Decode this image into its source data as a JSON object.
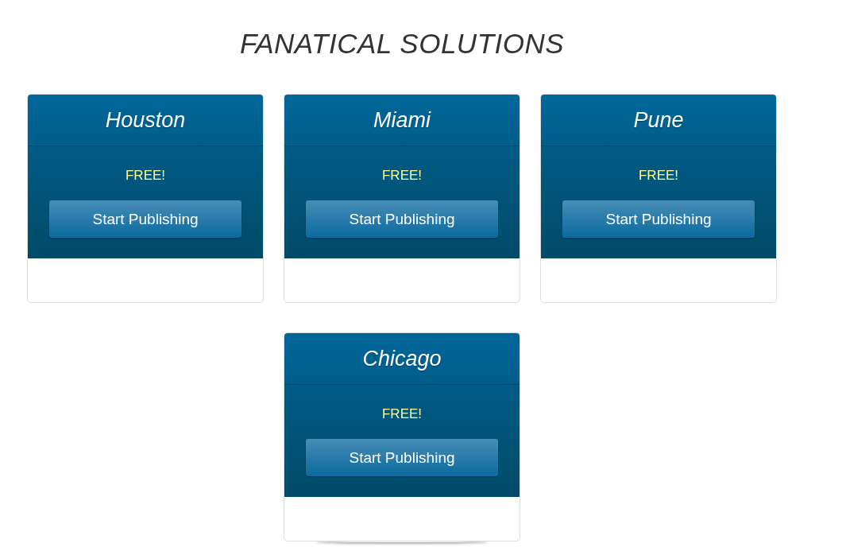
{
  "title": "FANATICAL SOLUTIONS",
  "plans": [
    {
      "city": "Houston",
      "price": "FREE!",
      "button": "Start Publishing"
    },
    {
      "city": "Miami",
      "price": "FREE!",
      "button": "Start Publishing"
    },
    {
      "city": "Pune",
      "price": "FREE!",
      "button": "Start Publishing"
    },
    {
      "city": "Chicago",
      "price": "FREE!",
      "button": "Start Publishing"
    }
  ]
}
